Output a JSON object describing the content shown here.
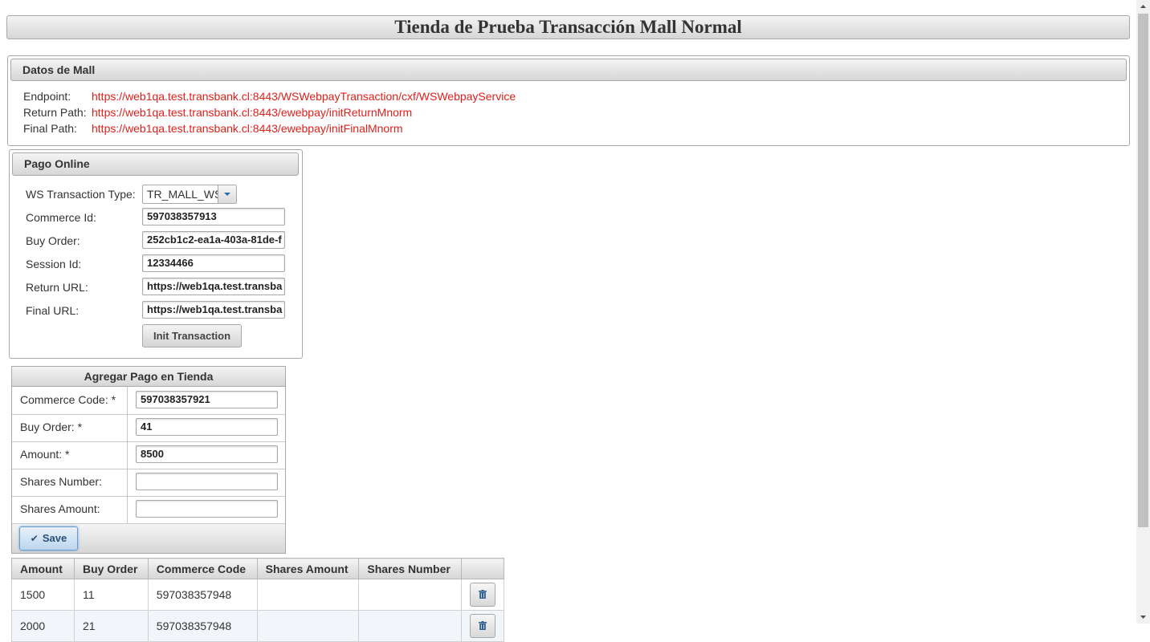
{
  "page": {
    "title": "Tienda de Prueba Transacción Mall Normal"
  },
  "mall": {
    "header": "Datos de Mall",
    "endpoint_label": "Endpoint:",
    "endpoint_value": "https://web1qa.test.transbank.cl:8443/WSWebpayTransaction/cxf/WSWebpayService",
    "return_label": "Return Path:",
    "return_value": "https://web1qa.test.transbank.cl:8443/ewebpay/initReturnMnorm",
    "final_label": "Final Path:",
    "final_value": "https://web1qa.test.transbank.cl:8443/ewebpay/initFinalMnorm"
  },
  "pago": {
    "header": "Pago Online",
    "ws_type_label": "WS Transaction Type:",
    "ws_type_value": "TR_MALL_WS",
    "commerce_id_label": "Commerce Id:",
    "commerce_id_value": "597038357913",
    "buy_order_label": "Buy Order:",
    "buy_order_value": "252cb1c2-ea1a-403a-81de-f",
    "session_id_label": "Session Id:",
    "session_id_value": "12334466",
    "return_url_label": "Return URL:",
    "return_url_value": "https://web1qa.test.transba",
    "final_url_label": "Final URL:",
    "final_url_value": "https://web1qa.test.transba",
    "init_button": "Init Transaction"
  },
  "agregar": {
    "header": "Agregar Pago en Tienda",
    "commerce_code_label": "Commerce Code: *",
    "commerce_code_value": "597038357921",
    "buy_order_label": "Buy Order: *",
    "buy_order_value": "41",
    "amount_label": "Amount: *",
    "amount_value": "8500",
    "shares_number_label": "Shares Number:",
    "shares_number_value": "",
    "shares_amount_label": "Shares Amount:",
    "shares_amount_value": "",
    "save_button": "Save"
  },
  "table": {
    "columns": [
      "Amount",
      "Buy Order",
      "Commerce Code",
      "Shares Amount",
      "Shares Number",
      ""
    ],
    "rows": [
      [
        "1500",
        "11",
        "597038357948",
        "",
        ""
      ],
      [
        "2000",
        "21",
        "597038357948",
        "",
        ""
      ]
    ]
  },
  "icons": {
    "save": "check-icon",
    "delete": "trash-icon",
    "select": "caret-down-icon"
  }
}
